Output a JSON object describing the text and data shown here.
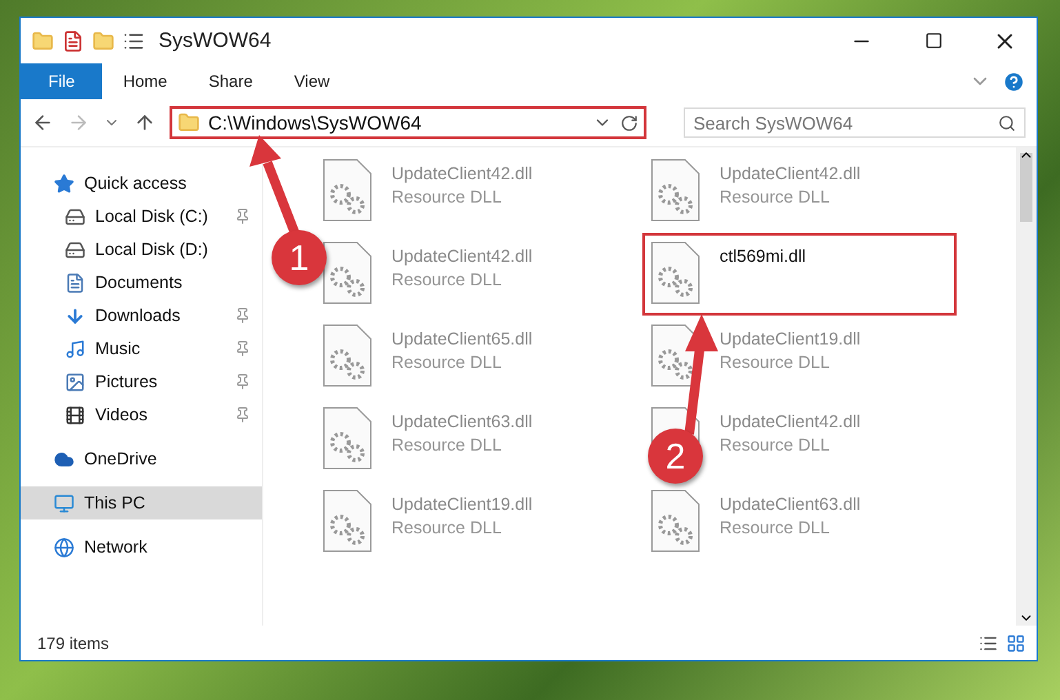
{
  "window": {
    "title": "SysWOW64"
  },
  "ribbon": {
    "tabs": [
      {
        "label": "File",
        "selected": true
      },
      {
        "label": "Home",
        "selected": false
      },
      {
        "label": "Share",
        "selected": false
      },
      {
        "label": "View",
        "selected": false
      }
    ]
  },
  "address": {
    "path": "C:\\Windows\\SysWOW64",
    "highlighted": true
  },
  "search": {
    "placeholder": "Search SysWOW64"
  },
  "navigation": [
    {
      "label": "Quick access",
      "kind": "star",
      "selected": false,
      "children": [
        {
          "label": "Local Disk (C:)",
          "kind": "drive",
          "pinned": true
        },
        {
          "label": "Local Disk (D:)",
          "kind": "drive",
          "pinned": false
        },
        {
          "label": "Documents",
          "kind": "documents",
          "pinned": false
        },
        {
          "label": "Downloads",
          "kind": "downloads",
          "pinned": true
        },
        {
          "label": "Music",
          "kind": "music",
          "pinned": true
        },
        {
          "label": "Pictures",
          "kind": "pictures",
          "pinned": true
        },
        {
          "label": "Videos",
          "kind": "videos",
          "pinned": true
        }
      ]
    },
    {
      "label": "OneDrive",
      "kind": "cloud",
      "selected": false
    },
    {
      "label": "This PC",
      "kind": "computer",
      "selected": true
    },
    {
      "label": "Network",
      "kind": "network",
      "selected": false
    }
  ],
  "files": [
    {
      "name": "UpdateClient42.dll",
      "type": "Resource DLL",
      "highlighted": false
    },
    {
      "name": "UpdateClient42.dll",
      "type": "Resource DLL",
      "highlighted": false
    },
    {
      "name": "UpdateClient42.dll",
      "type": "Resource DLL",
      "highlighted": false
    },
    {
      "name": "ctl569mi.dll",
      "highlighted": true
    },
    {
      "name": "UpdateClient65.dll",
      "type": "Resource DLL",
      "highlighted": false
    },
    {
      "name": "UpdateClient19.dll",
      "type": "Resource DLL",
      "highlighted": false
    },
    {
      "name": "UpdateClient63.dll",
      "type": "Resource DLL",
      "highlighted": false
    },
    {
      "name": "UpdateClient42.dll",
      "type": "Resource DLL",
      "highlighted": false
    },
    {
      "name": "UpdateClient19.dll",
      "type": "Resource DLL",
      "highlighted": false
    },
    {
      "name": "UpdateClient63.dll",
      "type": "Resource DLL",
      "highlighted": false
    }
  ],
  "annotations": [
    {
      "label": "1"
    },
    {
      "label": "2"
    }
  ],
  "status_bar": {
    "item_count": "179 items"
  }
}
